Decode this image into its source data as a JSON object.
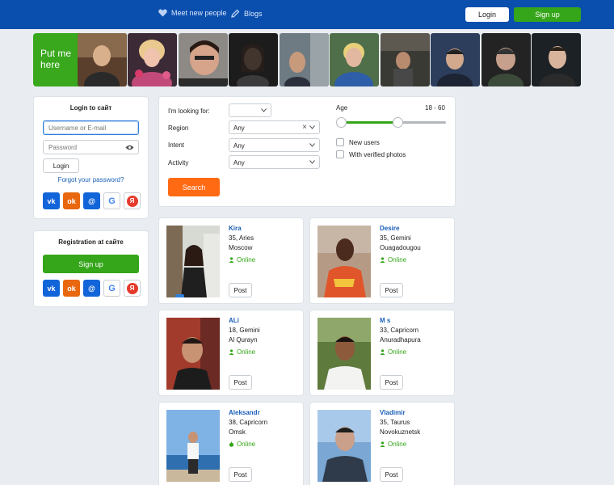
{
  "header": {
    "meet_link": "Meet new people",
    "blogs_link": "Blogs",
    "login_button": "Login",
    "signup_button": "Sign up",
    "colors": {
      "bar": "#0a4fae",
      "signup": "#35a51a"
    }
  },
  "strip": {
    "put_me_here": "Put me here"
  },
  "login_panel": {
    "title": "Login to сайт",
    "username_placeholder": "Username or E-mail",
    "password_placeholder": "Password",
    "login_button": "Login",
    "forgot_link": "Forgot your password?",
    "social_icons": [
      "vk-icon",
      "odnoklassniki-icon",
      "mailru-icon",
      "google-icon",
      "yandex-icon"
    ]
  },
  "register_panel": {
    "title": "Registration at сайте",
    "signup_button": "Sign up"
  },
  "search": {
    "looking_for_label": "I'm looking for:",
    "looking_for_value": "",
    "region_label": "Region",
    "region_value": "Any",
    "intent_label": "Intent",
    "intent_value": "Any",
    "activity_label": "Activity",
    "activity_value": "Any",
    "search_button": "Search",
    "age_label": "Age",
    "age_range": "18 - 60",
    "age_min": 18,
    "age_max": 60,
    "new_users_label": "New users",
    "verified_label": "With verified photos"
  },
  "profiles": [
    {
      "name": "Kira",
      "age": "35, Aries",
      "city": "Moscow",
      "status": "Online",
      "post": "Post"
    },
    {
      "name": "Desire",
      "age": "35, Gemini",
      "city": "Ouagadougou",
      "status": "Online",
      "post": "Post"
    },
    {
      "name": "ALi",
      "age": "18, Gemini",
      "city": "Al Qurayn",
      "status": "Online",
      "post": "Post"
    },
    {
      "name": "M s",
      "age": "33, Capricorn",
      "city": "Anuradhapura",
      "status": "Online",
      "post": "Post"
    },
    {
      "name": "Aleksandr",
      "age": "38, Capricorn",
      "city": "Omsk",
      "status": "Online",
      "post": "Post"
    },
    {
      "name": "Vladimir",
      "age": "35, Taurus",
      "city": "Novokuznetsk",
      "status": "Online",
      "post": "Post"
    }
  ]
}
